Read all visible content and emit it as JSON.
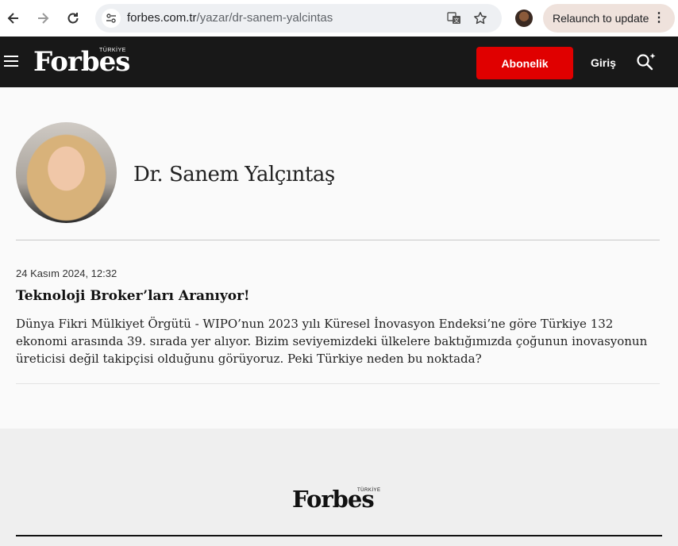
{
  "browser": {
    "url_host": "forbes.com.tr",
    "url_path": "/yazar/dr-sanem-yalcintas",
    "relaunch_label": "Relaunch to update",
    "icons": [
      "back-icon",
      "forward-icon",
      "reload-icon",
      "site-info-icon",
      "translate-icon",
      "bookmark-star-icon",
      "profile-avatar",
      "more-vertical-icon"
    ]
  },
  "header": {
    "logo": "Forbes",
    "logo_sub": "TÜRKİYE",
    "subscribe_label": "Abonelik",
    "login_label": "Giriş",
    "subscribe_color": "#e00000"
  },
  "author": {
    "name": "Dr. Sanem Yalçıntaş"
  },
  "articles": [
    {
      "date": "24 Kasım 2024, 12:32",
      "title": "Teknoloji Broker’ları Aranıyor!",
      "excerpt": "Dünya Fikri Mülkiyet Örgütü - WIPO’nun 2023 yılı Küresel İnovasyon Endeksi’ne göre Türkiye 132 ekonomi arasında 39. sırada yer alıyor. Bizim seviyemizdeki ülkelere baktığımızda çoğunun inovasyonun üreticisi değil takipçisi olduğunu görüyoruz. Peki Türkiye neden bu noktada?"
    }
  ],
  "footer": {
    "logo": "Forbes",
    "logo_sub": "TÜRKİYE"
  }
}
